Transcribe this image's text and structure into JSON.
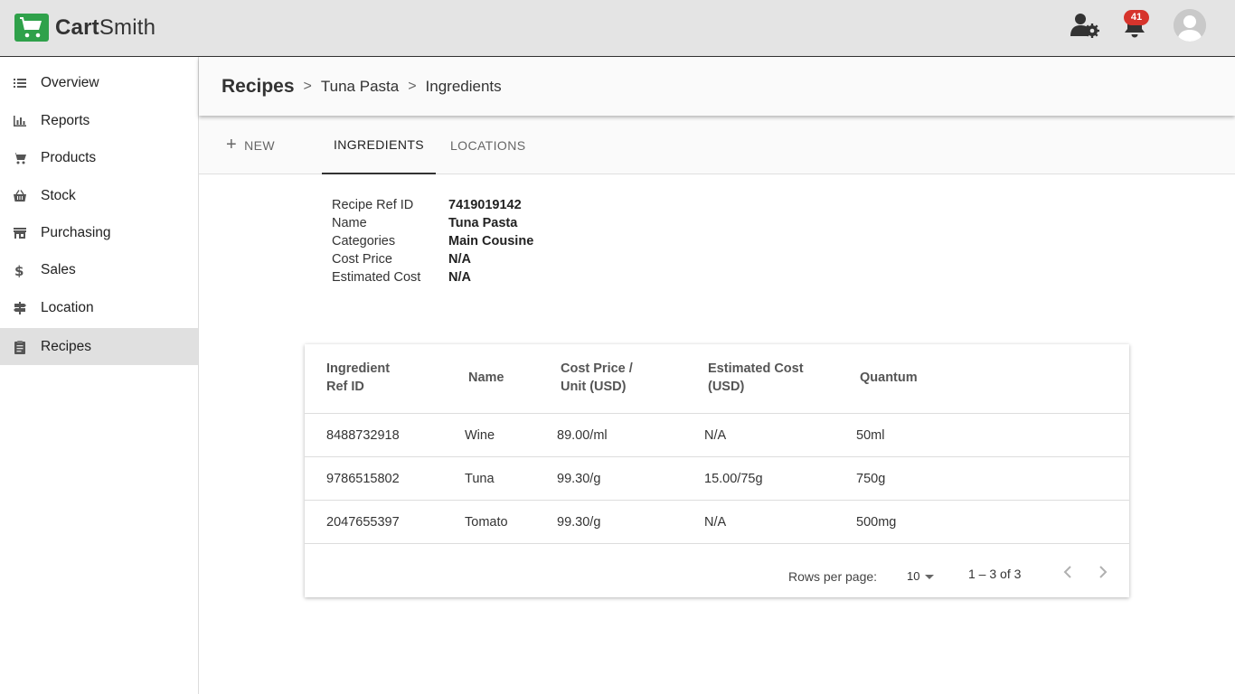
{
  "app": {
    "name_part1": "Cart",
    "name_part2": "Smith"
  },
  "topbar": {
    "notification_count": "41"
  },
  "sidebar": {
    "items": [
      {
        "label": "Overview",
        "icon": "list-icon"
      },
      {
        "label": "Reports",
        "icon": "bar-chart-icon"
      },
      {
        "label": "Products",
        "icon": "cart-icon"
      },
      {
        "label": "Stock",
        "icon": "basket-icon"
      },
      {
        "label": "Purchasing",
        "icon": "store-icon"
      },
      {
        "label": "Sales",
        "icon": "dollar-icon"
      },
      {
        "label": "Location",
        "icon": "signpost-icon"
      },
      {
        "label": "Recipes",
        "icon": "clipboard-icon"
      }
    ],
    "active": "Recipes"
  },
  "breadcrumb": {
    "root": "Recipes",
    "sep": ">",
    "item1": "Tuna Pasta",
    "item2": "Ingredients"
  },
  "tabs": {
    "new": "NEW",
    "ingredients": "INGREDIENTS",
    "locations": "LOCATIONS"
  },
  "recipe": {
    "fields": [
      {
        "key": "Recipe Ref ID",
        "value": "7419019142"
      },
      {
        "key": "Name",
        "value": "Tuna Pasta"
      },
      {
        "key": "Categories",
        "value": "Main Cousine"
      },
      {
        "key": "Cost Price",
        "value": "N/A"
      },
      {
        "key": "Estimated Cost",
        "value": "N/A"
      }
    ]
  },
  "table": {
    "headers": {
      "ref_line1": "Ingredient",
      "ref_line2": "Ref ID",
      "name": "Name",
      "cost_line1": "Cost Price /",
      "cost_line2": "Unit (USD)",
      "est_line1": "Estimated Cost",
      "est_line2": "(USD)",
      "quantum": "Quantum"
    },
    "rows": [
      {
        "ref": "8488732918",
        "name": "Wine",
        "cost": "89.00/ml",
        "est": "N/A",
        "quantum": "50ml"
      },
      {
        "ref": "9786515802",
        "name": "Tuna",
        "cost": "99.30/g",
        "est": "15.00/75g",
        "quantum": "750g"
      },
      {
        "ref": "2047655397",
        "name": "Tomato",
        "cost": "99.30/g",
        "est": "N/A",
        "quantum": "500mg"
      }
    ],
    "footer": {
      "rows_per_page_label": "Rows per page:",
      "rows_per_page": "10",
      "range": "1 – 3 of 3"
    }
  },
  "colors": {
    "brand_green": "#2fa14a",
    "badge_red": "#d6342c",
    "active_nav": "#e0e0e0"
  }
}
